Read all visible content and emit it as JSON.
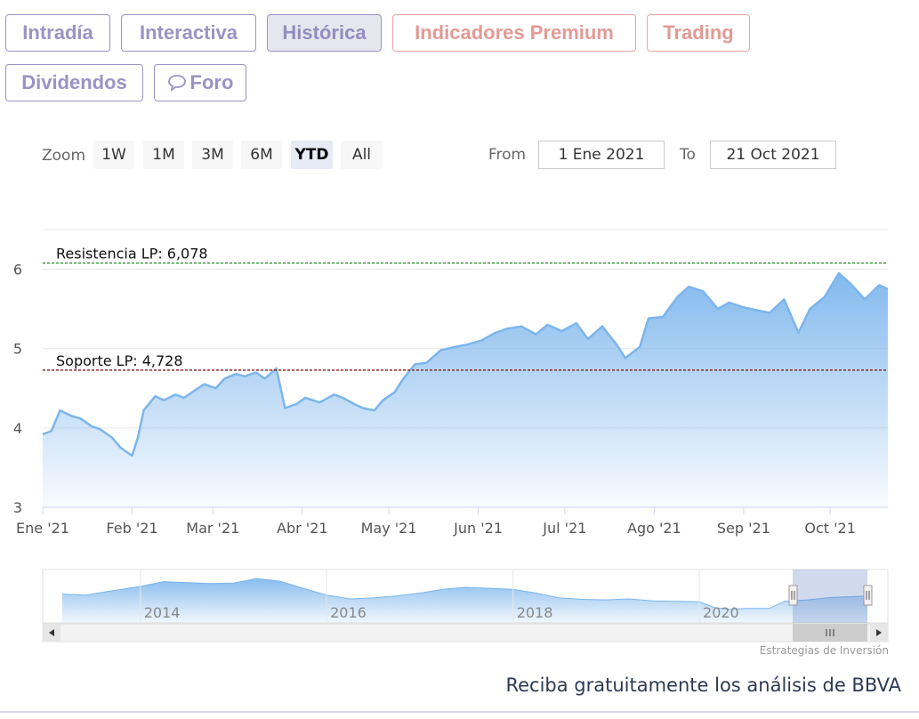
{
  "tabs": [
    {
      "label": "Intradía",
      "style": "purple",
      "active": false
    },
    {
      "label": "Interactiva",
      "style": "purple",
      "active": false
    },
    {
      "label": "Histórica",
      "style": "purple",
      "active": true
    },
    {
      "label": "Indicadores Premium",
      "style": "red",
      "active": false
    },
    {
      "label": "Trading",
      "style": "red",
      "active": false
    },
    {
      "label": "Dividendos",
      "style": "purple",
      "active": false
    },
    {
      "label": "Foro",
      "style": "purple",
      "active": false,
      "icon": "speech-bubble-icon"
    }
  ],
  "colors": {
    "tab_purple": "#9a93c4",
    "tab_red": "#e39a95",
    "line": "#7cb5ec",
    "resistance": "#1a8c1a",
    "support": "#8b1a1a"
  },
  "range_selector": {
    "zoom_label": "Zoom",
    "buttons": [
      "1W",
      "1M",
      "3M",
      "6M",
      "YTD",
      "All"
    ],
    "selected": "YTD",
    "from_label": "From",
    "from_value": "1 Ene 2021",
    "to_label": "To",
    "to_value": "21 Oct 2021"
  },
  "chart_data": {
    "type": "area",
    "title": "",
    "xlabel": "",
    "ylabel": "",
    "ylim": [
      3,
      6.5
    ],
    "y_ticks": [
      3,
      4,
      5,
      6
    ],
    "x_ticks": [
      "Ene '21",
      "Feb '21",
      "Mar '21",
      "Abr '21",
      "May '21",
      "Jun '21",
      "Jul '21",
      "Ago '21",
      "Sep '21",
      "Oct '21"
    ],
    "x_ticks_dates": [
      "2021-01-01",
      "2021-02-01",
      "2021-03-01",
      "2021-04-01",
      "2021-05-01",
      "2021-06-01",
      "2021-07-01",
      "2021-08-01",
      "2021-09-01",
      "2021-10-01"
    ],
    "xlim": [
      "2021-01-01",
      "2021-10-21"
    ],
    "series": [
      {
        "x": [
          "2021-01-01",
          "2021-01-04",
          "2021-01-07",
          "2021-01-11",
          "2021-01-14",
          "2021-01-18",
          "2021-01-21",
          "2021-01-25",
          "2021-01-28",
          "2021-02-01",
          "2021-02-03",
          "2021-02-05",
          "2021-02-09",
          "2021-02-12",
          "2021-02-16",
          "2021-02-19",
          "2021-02-23",
          "2021-02-26",
          "2021-03-02",
          "2021-03-05",
          "2021-03-09",
          "2021-03-12",
          "2021-03-16",
          "2021-03-19",
          "2021-03-23",
          "2021-03-26",
          "2021-03-30",
          "2021-04-02",
          "2021-04-07",
          "2021-04-12",
          "2021-04-15",
          "2021-04-19",
          "2021-04-22",
          "2021-04-26",
          "2021-04-29",
          "2021-05-03",
          "2021-05-06",
          "2021-05-10",
          "2021-05-14",
          "2021-05-19",
          "2021-05-24",
          "2021-05-28",
          "2021-06-02",
          "2021-06-07",
          "2021-06-11",
          "2021-06-16",
          "2021-06-21",
          "2021-06-25",
          "2021-06-30",
          "2021-07-05",
          "2021-07-09",
          "2021-07-14",
          "2021-07-19",
          "2021-07-22",
          "2021-07-27",
          "2021-07-30",
          "2021-08-04",
          "2021-08-09",
          "2021-08-13",
          "2021-08-18",
          "2021-08-23",
          "2021-08-27",
          "2021-09-01",
          "2021-09-06",
          "2021-09-10",
          "2021-09-15",
          "2021-09-20",
          "2021-09-24",
          "2021-09-29",
          "2021-10-04",
          "2021-10-08",
          "2021-10-13",
          "2021-10-18",
          "2021-10-21"
        ],
        "values": [
          3.92,
          3.96,
          4.22,
          4.15,
          4.12,
          4.02,
          3.98,
          3.88,
          3.75,
          3.65,
          3.88,
          4.22,
          4.4,
          4.35,
          4.42,
          4.38,
          4.48,
          4.55,
          4.5,
          4.62,
          4.68,
          4.65,
          4.7,
          4.62,
          4.75,
          4.25,
          4.3,
          4.38,
          4.32,
          4.42,
          4.38,
          4.3,
          4.25,
          4.22,
          4.35,
          4.45,
          4.62,
          4.8,
          4.82,
          4.98,
          5.02,
          5.05,
          5.1,
          5.2,
          5.25,
          5.28,
          5.18,
          5.3,
          5.22,
          5.32,
          5.12,
          5.28,
          5.05,
          4.88,
          5.02,
          5.38,
          5.4,
          5.65,
          5.78,
          5.72,
          5.5,
          5.58,
          5.52,
          5.48,
          5.45,
          5.62,
          5.2,
          5.5,
          5.65,
          5.95,
          5.82,
          5.62,
          5.8,
          5.75
        ]
      }
    ],
    "plot_lines": [
      {
        "label": "Resistencia LP: 6,078",
        "value": 6.078,
        "color": "#1a8c1a"
      },
      {
        "label": "Soporte LP: 4,728",
        "value": 4.728,
        "color": "#8b1a1a"
      }
    ],
    "navigator": {
      "x_ticks": [
        "2014",
        "2016",
        "2018",
        "2020"
      ],
      "x_ticks_dates": [
        "2014-01-01",
        "2016-01-01",
        "2018-01-01",
        "2020-01-01"
      ],
      "xlim": [
        "2013-03-01",
        "2021-10-21"
      ],
      "selected_range": [
        "2021-01-01",
        "2021-10-21"
      ],
      "series_x": [
        "2013-03-01",
        "2013-06-01",
        "2013-09-01",
        "2014-01-01",
        "2014-04-01",
        "2014-07-01",
        "2014-10-01",
        "2015-01-01",
        "2015-04-01",
        "2015-07-01",
        "2015-10-01",
        "2016-01-01",
        "2016-04-01",
        "2016-07-01",
        "2016-10-01",
        "2017-01-01",
        "2017-04-01",
        "2017-07-01",
        "2017-10-01",
        "2018-01-01",
        "2018-04-01",
        "2018-07-01",
        "2018-10-01",
        "2019-01-01",
        "2019-04-01",
        "2019-07-01",
        "2019-10-01",
        "2020-01-01",
        "2020-03-01",
        "2020-05-01",
        "2020-07-01",
        "2020-10-01",
        "2020-12-01",
        "2021-03-01",
        "2021-06-01",
        "2021-10-21"
      ],
      "series_values": [
        6.0,
        5.8,
        6.6,
        7.6,
        8.6,
        8.4,
        8.2,
        8.3,
        9.2,
        8.7,
        7.2,
        5.8,
        5.0,
        5.2,
        5.6,
        6.2,
        7.0,
        7.4,
        7.2,
        7.0,
        6.2,
        5.2,
        4.9,
        4.8,
        5.0,
        4.6,
        4.5,
        4.4,
        3.2,
        2.8,
        3.0,
        3.0,
        4.5,
        4.8,
        5.3,
        5.6
      ]
    }
  },
  "credits": "Estrategias de Inversión",
  "promo_text": "Reciba gratuitamente los análisis de BBVA"
}
